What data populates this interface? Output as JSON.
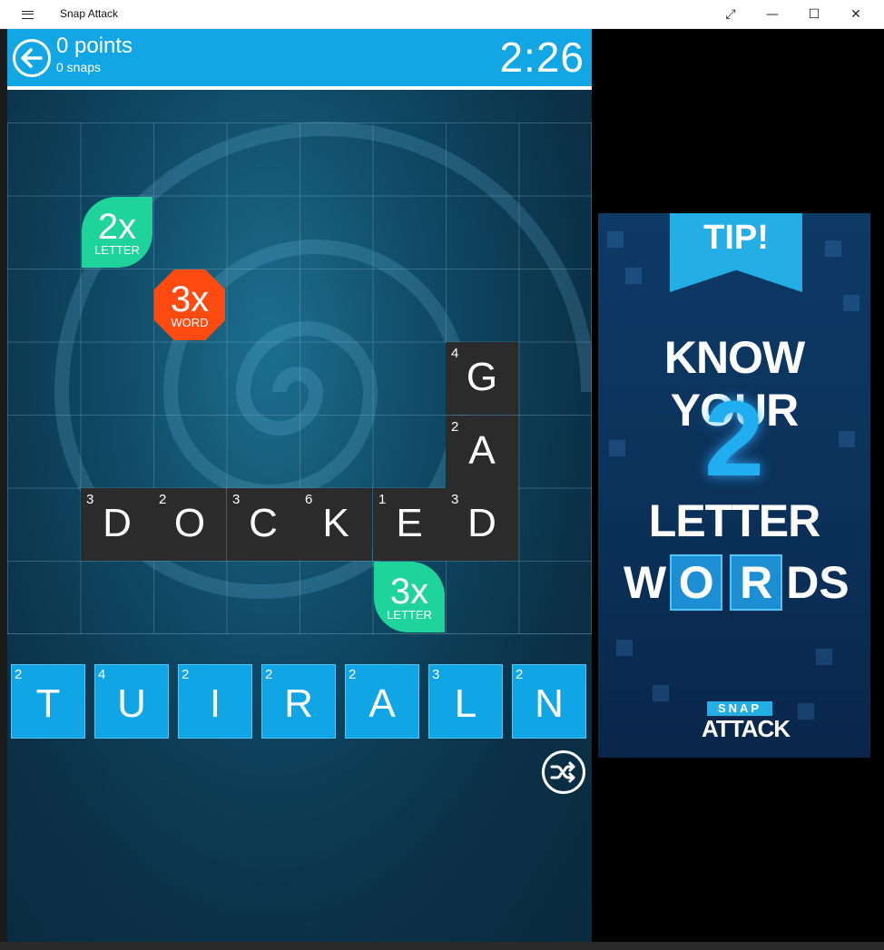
{
  "window": {
    "title": "Snap Attack",
    "menu_icon": "hamburger-menu-icon",
    "fullscreen_icon": "fullscreen-icon",
    "minimize_icon": "minimize-icon",
    "maximize_icon": "maximize-icon",
    "close_icon": "close-icon"
  },
  "header": {
    "points": "0 points",
    "snaps": "0 snaps",
    "timer": "2:26",
    "back_icon": "back-arrow-icon"
  },
  "bonuses": [
    {
      "big": "2x",
      "small": "LETTER",
      "color": "#1fd49a"
    },
    {
      "big": "3x",
      "small": "WORD",
      "color": "#ff4a12"
    },
    {
      "big": "3x",
      "small": "LETTER",
      "color": "#1fd49a"
    }
  ],
  "board_tiles": [
    {
      "letter": "G",
      "value": "4"
    },
    {
      "letter": "A",
      "value": "2"
    },
    {
      "letter": "D",
      "value": "3"
    },
    {
      "letter": "O",
      "value": "2"
    },
    {
      "letter": "C",
      "value": "3"
    },
    {
      "letter": "K",
      "value": "6"
    },
    {
      "letter": "E",
      "value": "1"
    },
    {
      "letter": "D",
      "value": "3"
    }
  ],
  "rack": [
    {
      "letter": "T",
      "value": "2"
    },
    {
      "letter": "U",
      "value": "4"
    },
    {
      "letter": "I",
      "value": "2"
    },
    {
      "letter": "R",
      "value": "2"
    },
    {
      "letter": "A",
      "value": "2"
    },
    {
      "letter": "L",
      "value": "3"
    },
    {
      "letter": "N",
      "value": "2"
    }
  ],
  "shuffle_icon": "shuffle-icon",
  "ad": {
    "ribbon": "TIP!",
    "line1": "KNOW YOUR",
    "number": "2",
    "line3": "LETTER",
    "words": {
      "w": "W",
      "box1": "O",
      "box2": "R",
      "ds": "DS"
    },
    "logo_top": "SNAP",
    "logo_bottom": "ATTACK"
  },
  "colors": {
    "header_blue": "#12a6e4",
    "tile_blue": "#10a5e5",
    "placed_tile": "#2b2b2b",
    "bonus_green": "#1fd49a",
    "bonus_orange": "#ff4a12"
  }
}
